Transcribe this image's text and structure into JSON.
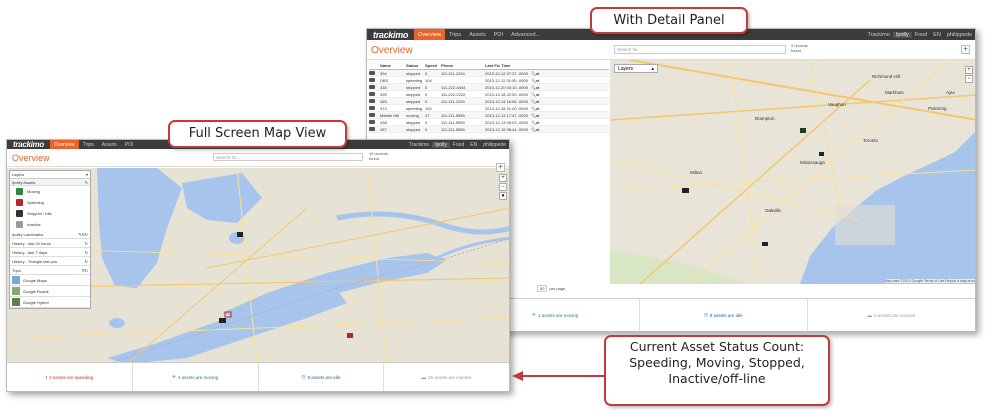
{
  "callouts": {
    "full_screen": "Full Screen Map View",
    "detail_panel": "With Detail Panel",
    "status_lines": [
      "Current Asset Status Count:",
      "Speeding, Moving, Stopped,",
      "Inactive/off-line"
    ]
  },
  "brand": "trackimo",
  "nav": [
    "Overview",
    "Trips",
    "Assets",
    "POI"
  ],
  "nav_detail_extra": "Advanced...",
  "page_title": "Overview",
  "search_placeholder": "Search for...",
  "stats_fs": [
    "19 records",
    "found"
  ],
  "stats_dp": [
    "9 records",
    "found"
  ],
  "add_glyph": "+",
  "topright": [
    "Trackimo",
    "Ipolly",
    "Food",
    "EN",
    "philippede"
  ],
  "layers": {
    "title": "Layers",
    "group_assets": "Ipolity Assets",
    "legend": [
      {
        "label": "Moving",
        "color": "#2b8a3e"
      },
      {
        "label": "Speeding",
        "color": "#b3262b"
      },
      {
        "label": "Stopped / Idle",
        "color": "#333333"
      },
      {
        "label": "Inactive",
        "color": "#9a9a9a"
      }
    ],
    "rows": [
      "Ipolity Landmarks",
      "History - last 24 hours",
      "History - last 7 days",
      "History - Triangle last pos",
      "Trips"
    ],
    "maps": [
      "Google Maps",
      "Google Roads",
      "Google Hybrid"
    ]
  },
  "status_fs": [
    {
      "icon": "!",
      "text": "3 assets are speeding",
      "color": "#c0392b"
    },
    {
      "icon": "✈",
      "text": "4 assets are moving",
      "color": "#2b8a3e"
    },
    {
      "icon": "◷",
      "text": "8 assets are idle",
      "color": "#2b5d9a"
    },
    {
      "icon": "▬",
      "text": "15 assets are inactive",
      "color": "#999999"
    }
  ],
  "status_dp": [
    {
      "icon": "✈",
      "text": "1 assets are moving",
      "color": "#2b8a3e"
    },
    {
      "icon": "◷",
      "text": "8 assets are idle",
      "color": "#2b5d9a"
    },
    {
      "icon": "▬",
      "text": "6 assets are inactive",
      "color": "#999999"
    }
  ],
  "table": {
    "headers": [
      "",
      "Name",
      "Status",
      "Speed",
      "Phone",
      "Last Fix Time",
      ""
    ],
    "rows": [
      [
        "",
        "394",
        "stopped",
        "0",
        "111-111-1234",
        "2013-12-12 07:37 -0500",
        "🔍⇄"
      ],
      [
        "",
        "DBS",
        "speeding",
        "104",
        "",
        "2013-12-12 01:55 -0500",
        "🔍⇄"
      ],
      [
        "",
        "435",
        "stopped",
        "0",
        "111-222-4444",
        "2013-12-20 03:10 -0500",
        "🔍⇄"
      ],
      [
        "",
        "495",
        "stopped",
        "0",
        "111-222-2222",
        "2013-12-18 22:50 -0500",
        "🔍⇄"
      ],
      [
        "",
        "465",
        "stopped",
        "0",
        "111-111-1234",
        "2013-12-14 16:56 -0500",
        "🔍⇄"
      ],
      [
        "",
        "474",
        "speeding",
        "104",
        "",
        "2013-12-18 21:00 -0500",
        "🔍⇄"
      ],
      [
        "",
        "Marble Hill",
        "moving",
        "37",
        "111-111-5555",
        "2013-12-13 17:47 -0500",
        "🔍⇄"
      ],
      [
        "",
        "438",
        "stopped",
        "0",
        "111-111-5555",
        "2013-12-13 09:03 -0500",
        "🔍⇄"
      ],
      [
        "",
        "457",
        "stopped",
        "0",
        "111-111-5555",
        "2013-12-15 06:44 -0500",
        "🔍⇄"
      ]
    ]
  },
  "pager": {
    "size": "50",
    "label": "per page"
  },
  "map_labels": [
    "Toronto",
    "Mississauga",
    "Brampton",
    "Oakville",
    "Milton",
    "Vaughan",
    "Markham",
    "Richmond Hill",
    "Ajax",
    "Pickering"
  ],
  "map_copy": "Map data ©2013 Google  Terms of Use  Report a map error"
}
